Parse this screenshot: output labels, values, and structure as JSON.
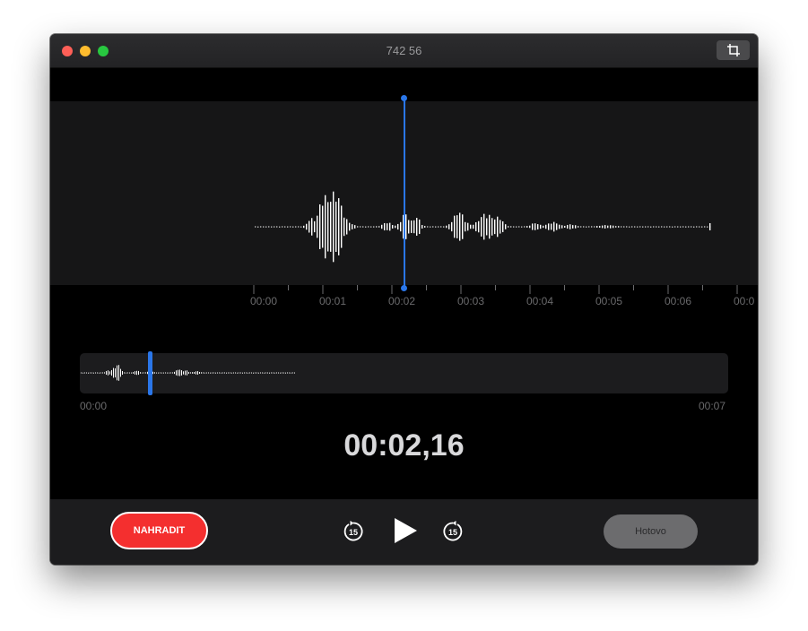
{
  "window": {
    "title": "742 56"
  },
  "colors": {
    "accent": "#2a76e9",
    "record_red": "#f42f2f",
    "wave": "#ffffff"
  },
  "ruler": {
    "labels": [
      "00:00",
      "00:01",
      "00:02",
      "00:03",
      "00:04",
      "00:05",
      "00:06",
      "00:0"
    ]
  },
  "overview": {
    "start_label": "00:00",
    "end_label": "00:07",
    "position_fraction": 0.31
  },
  "playback": {
    "current_time": "00:02,16",
    "skip_back_label": "15",
    "skip_forward_label": "15"
  },
  "buttons": {
    "replace_label": "NAHRADIT",
    "done_label": "Hotovo"
  },
  "icons": {
    "crop": "crop-icon",
    "skip_back": "skip-back-15-icon",
    "play": "play-icon",
    "skip_forward": "skip-forward-15-icon"
  }
}
